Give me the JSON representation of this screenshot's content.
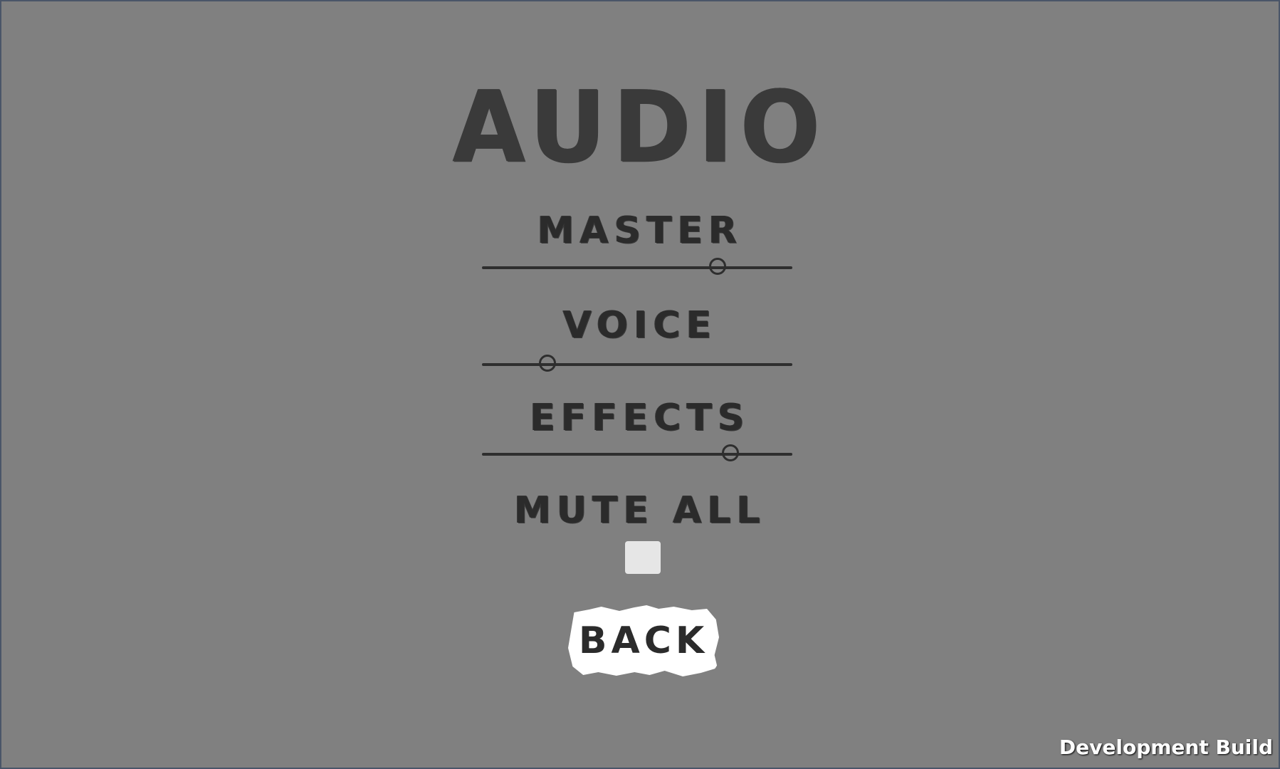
{
  "menu": {
    "title": "AUDIO",
    "master": {
      "label": "MASTER",
      "level": 0.76
    },
    "voice": {
      "label": "VOICE",
      "level": 0.21
    },
    "effects": {
      "label": "EFFECTS",
      "level": 0.8
    },
    "mute_all": {
      "label": "MUTE ALL",
      "checked": false
    },
    "back_label": "BACK"
  },
  "footer": {
    "build_label": "Development Build"
  },
  "colors": {
    "background": "#808080",
    "ink": "#2b2b2b",
    "checkbox": "#e6e6e6",
    "button": "#ffffff"
  }
}
